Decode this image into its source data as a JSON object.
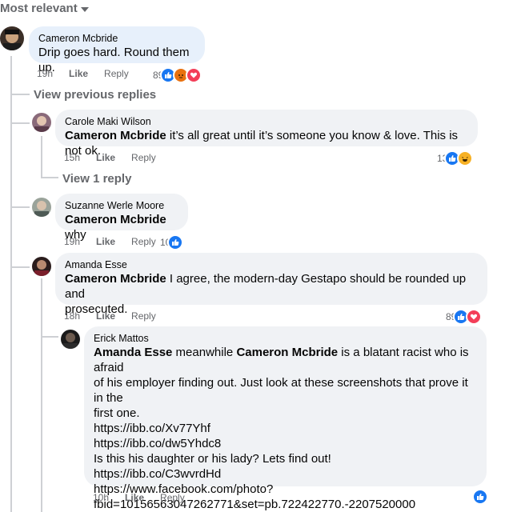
{
  "sort": {
    "label": "Most relevant"
  },
  "comments": [
    {
      "author": "Cameron Mcbride",
      "mention": "",
      "text": "Drip goes hard. Round them up.",
      "time": "19h",
      "like": "Like",
      "reply": "Reply",
      "reactions": "89"
    },
    {
      "author": "Carole Maki Wilson",
      "mention": "Cameron Mcbride",
      "text": " it’s all great until it’s someone you know & love. This is not ok.",
      "time": "15h",
      "like": "Like",
      "reply": "Reply",
      "reactions": "13"
    },
    {
      "author": "Suzanne Werle Moore",
      "mention": "Cameron Mcbride",
      "text": " why",
      "time": "19h",
      "like": "Like",
      "reply": "Reply",
      "reactions": "10"
    },
    {
      "author": "Amanda Esse",
      "mention": "Cameron Mcbride",
      "text1": " I agree, the modern-day Gestapo should be rounded up and",
      "text2": "prosecuted.",
      "time": "18h",
      "like": "Like",
      "reply": "Reply",
      "reactions": "89"
    },
    {
      "author": "Erick Mattos",
      "mention1": "Amanda Esse",
      "mid": " meanwhile ",
      "mention2": "Cameron Mcbride",
      "line1rest": " is a blatant racist who is afraid",
      "line2": "of his employer finding out. Just look at these screenshots that prove it in the",
      "line3": "first one.",
      "line4": "https://ibb.co/Xv77Yhf",
      "line5": "https://ibb.co/dw5Yhdc8",
      "line6": "Is this his daughter or his lady? Lets find out!",
      "line7": "https://ibb.co/C3wvrdHd",
      "line8": "https://www.facebook.com/photo?",
      "line9": "fbid=10156563047262771&set=pb.722422770.-2207520000",
      "time": "10h",
      "like": "Like",
      "reply": "Reply"
    }
  ],
  "links": {
    "view_previous": "View previous replies",
    "view_one": "View 1 reply"
  },
  "icons": {
    "like": "thumbs-up-icon",
    "angry": "angry-face-icon",
    "love": "heart-icon",
    "haha": "laughing-face-icon"
  },
  "colors": {
    "like": "#1877f2",
    "angry": "#e9710f",
    "love": "#f33e58",
    "haha": "#f7b125",
    "bubble": "#f0f2f5",
    "bubble_active": "#e7f0fb"
  }
}
